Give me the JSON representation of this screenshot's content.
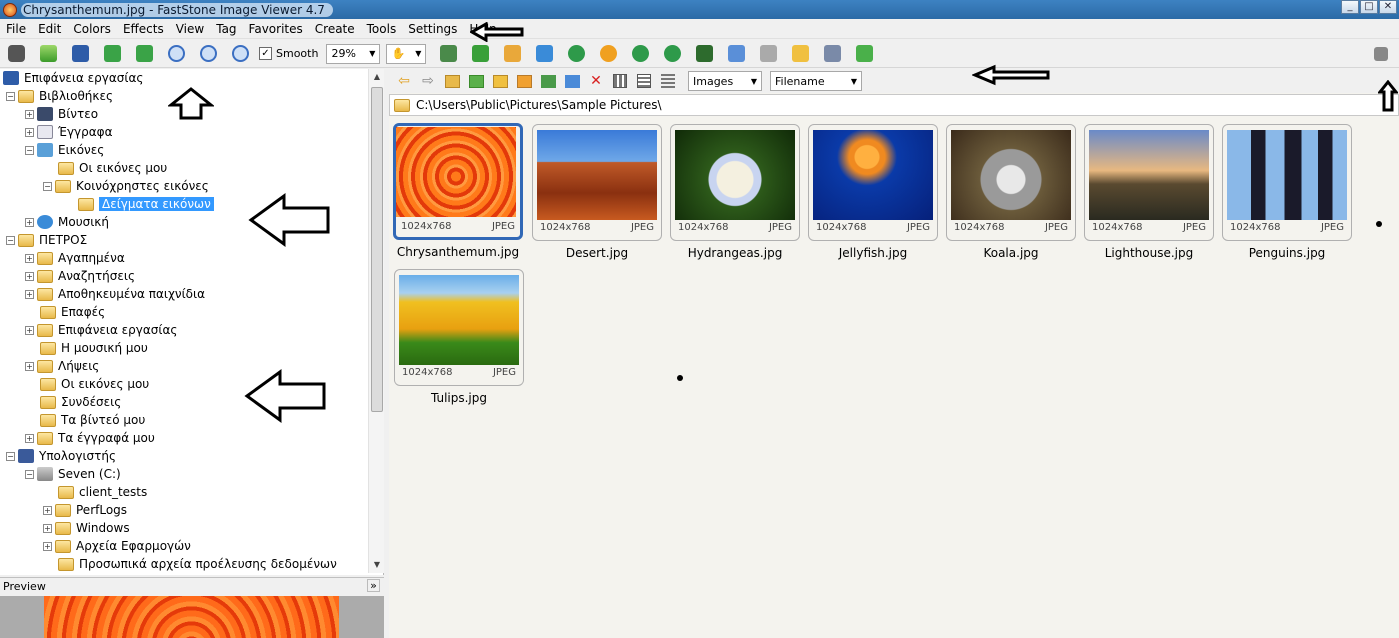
{
  "window": {
    "title": "Chrysanthemum.jpg  -  FastStone Image Viewer 4.7",
    "btn_min": "_",
    "btn_max": "□",
    "btn_close": "✕"
  },
  "menu": [
    "File",
    "Edit",
    "Colors",
    "Effects",
    "View",
    "Tag",
    "Favorites",
    "Create",
    "Tools",
    "Settings",
    "Help"
  ],
  "toolbar": {
    "smooth_label": "Smooth",
    "smooth_checked": "✓",
    "zoom_value": "29%"
  },
  "nav": {
    "filter_value": "Images",
    "sort_value": "Filename"
  },
  "path": "C:\\Users\\Public\\Pictures\\Sample Pictures\\",
  "tree": [
    {
      "label": "Επιφάνεια εργασίας"
    },
    {
      "label": "Βιβλιοθήκες"
    },
    {
      "label": "Βίντεο"
    },
    {
      "label": "Έγγραφα"
    },
    {
      "label": "Εικόνες"
    },
    {
      "label": "Οι εικόνες μου"
    },
    {
      "label": "Κοινόχρηστες εικόνες"
    },
    {
      "label": "Δείγματα εικόνων"
    },
    {
      "label": "Μουσική"
    },
    {
      "label": "ΠΕΤΡΟΣ"
    },
    {
      "label": "Αγαπημένα"
    },
    {
      "label": "Αναζητήσεις"
    },
    {
      "label": "Αποθηκευμένα παιχνίδια"
    },
    {
      "label": "Επαφές"
    },
    {
      "label": "Επιφάνεια εργασίας"
    },
    {
      "label": "Η μουσική μου"
    },
    {
      "label": "Λήψεις"
    },
    {
      "label": "Οι εικόνες μου"
    },
    {
      "label": "Συνδέσεις"
    },
    {
      "label": "Τα βίντεό μου"
    },
    {
      "label": "Τα έγγραφά μου"
    },
    {
      "label": "Υπολογιστής"
    },
    {
      "label": "Seven (C:)"
    },
    {
      "label": "client_tests"
    },
    {
      "label": "PerfLogs"
    },
    {
      "label": "Windows"
    },
    {
      "label": "Αρχεία Εφαρμογών"
    },
    {
      "label": "Προσωπικά αρχεία προέλευσης δεδομένων"
    }
  ],
  "preview": {
    "label": "Preview",
    "toggle": "»"
  },
  "thumbnails": [
    {
      "name": "Chrysanthemum.jpg",
      "dims": "1024x768",
      "format": "JPEG"
    },
    {
      "name": "Desert.jpg",
      "dims": "1024x768",
      "format": "JPEG"
    },
    {
      "name": "Hydrangeas.jpg",
      "dims": "1024x768",
      "format": "JPEG"
    },
    {
      "name": "Jellyfish.jpg",
      "dims": "1024x768",
      "format": "JPEG"
    },
    {
      "name": "Koala.jpg",
      "dims": "1024x768",
      "format": "JPEG"
    },
    {
      "name": "Lighthouse.jpg",
      "dims": "1024x768",
      "format": "JPEG"
    },
    {
      "name": "Penguins.jpg",
      "dims": "1024x768",
      "format": "JPEG"
    },
    {
      "name": "Tulips.jpg",
      "dims": "1024x768",
      "format": "JPEG"
    }
  ],
  "colors": {
    "selection": "#3399ff",
    "active_frame": "#3168b6",
    "title_bar": "#3d82c2"
  }
}
